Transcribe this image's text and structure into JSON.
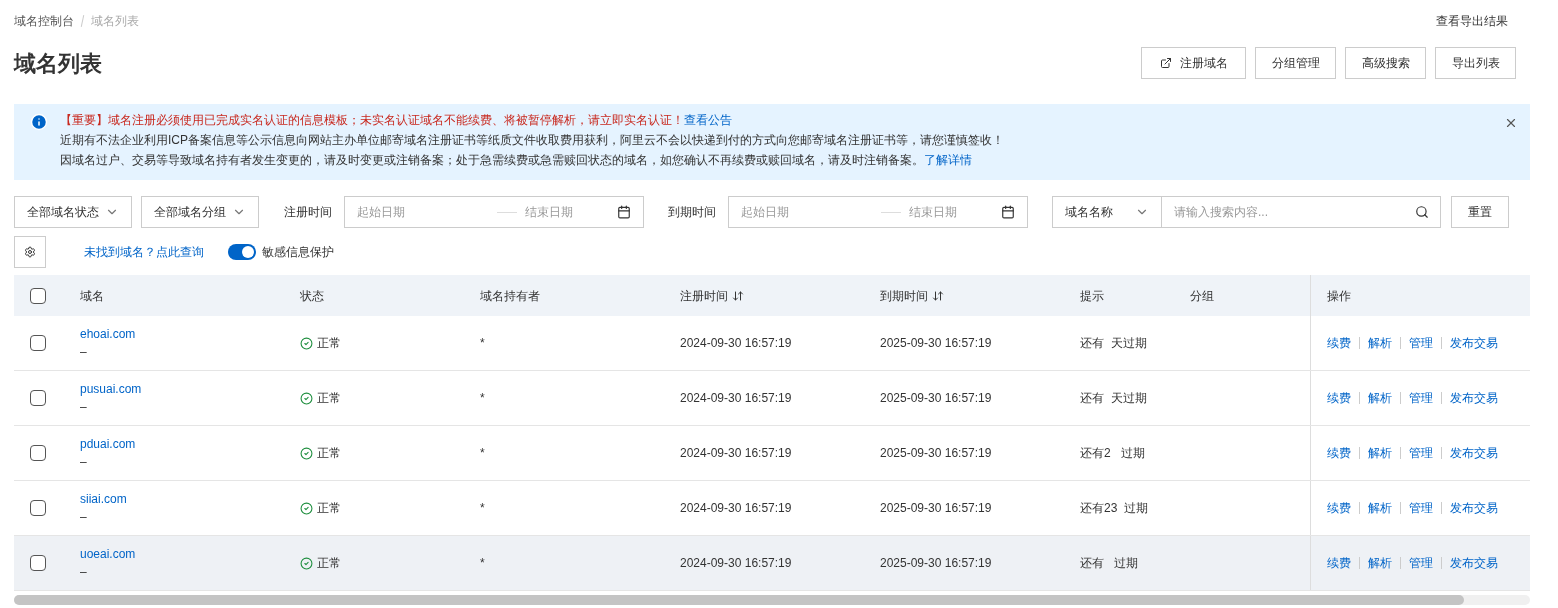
{
  "breadcrumb": [
    {
      "label": "域名控制台",
      "current": false
    },
    {
      "label": "域名列表",
      "current": true
    }
  ],
  "export_results_link": "查看导出结果",
  "title": "域名列表",
  "toolbar_buttons": [
    {
      "label": "注册域名",
      "kind": "external"
    },
    {
      "label": "分组管理",
      "kind": "plain"
    },
    {
      "label": "高级搜索",
      "kind": "plain"
    },
    {
      "label": "导出列表",
      "kind": "plain"
    }
  ],
  "notice": {
    "important": "【重要】域名注册必须使用已完成实名认证的信息模板；未实名认证域名不能续费、将被暂停解析，请立即实名认证！",
    "important_link": "查看公告",
    "line_2": "近期有不法企业利用ICP备案信息等公示信息向网站主办单位邮寄域名注册证书等纸质文件收取费用获利，阿里云不会以快递到付的方式向您邮寄域名注册证书等，请您谨慎签收！",
    "line_3": "因域名过户、交易等导致域名持有者发生变更的，请及时变更或注销备案；处于急需续费或急需赎回状态的域名，如您确认不再续费或赎回域名，请及时注销备案。",
    "line_3_link": "了解详情"
  },
  "filters": {
    "status_select": "全部域名状态",
    "group_select": "全部域名分组",
    "reg_label": "注册时间",
    "reg_start": "起始日期",
    "reg_end": "结束日期",
    "exp_label": "到期时间",
    "exp_start": "起始日期",
    "exp_end": "结束日期",
    "search_type": "域名名称",
    "search_placeholder": "请输入搜索内容...",
    "reset": "重置"
  },
  "not_found_link": "未找到域名？点此查询",
  "sensitive_toggle": {
    "label": "敏感信息保护",
    "on": true
  },
  "table": {
    "select_all_checked": false,
    "columns": [
      {
        "label": "域名",
        "sortable": false
      },
      {
        "label": "状态",
        "sortable": false
      },
      {
        "label": "域名持有者",
        "sortable": false
      },
      {
        "label": "注册时间",
        "sortable": true
      },
      {
        "label": "到期时间",
        "sortable": true
      },
      {
        "label": "提示",
        "sortable": false
      },
      {
        "label": "分组",
        "sortable": false
      },
      {
        "label": "操作",
        "sortable": false
      }
    ],
    "rows": [
      {
        "checked": false,
        "highlighted": false,
        "domain": "ehoai.com",
        "sub": "–",
        "status": "正常",
        "owner": "*",
        "registered": "2024-09-30 16:57:19",
        "expires": "2025-09-30 16:57:19",
        "hint": "还有  天过期",
        "actions": [
          "续费",
          "解析",
          "管理",
          "发布交易"
        ]
      },
      {
        "checked": false,
        "highlighted": false,
        "domain": "pusuai.com",
        "sub": "–",
        "status": "正常",
        "owner": "*",
        "registered": "2024-09-30 16:57:19",
        "expires": "2025-09-30 16:57:19",
        "hint": "还有  天过期",
        "actions": [
          "续费",
          "解析",
          "管理",
          "发布交易"
        ]
      },
      {
        "checked": false,
        "highlighted": false,
        "domain": "pduai.com",
        "sub": "–",
        "status": "正常",
        "owner": "*",
        "registered": "2024-09-30 16:57:19",
        "expires": "2025-09-30 16:57:19",
        "hint": "还有2   过期",
        "actions": [
          "续费",
          "解析",
          "管理",
          "发布交易"
        ]
      },
      {
        "checked": false,
        "highlighted": false,
        "domain": "siiai.com",
        "sub": "–",
        "status": "正常",
        "owner": "*",
        "registered": "2024-09-30 16:57:19",
        "expires": "2025-09-30 16:57:19",
        "hint": "还有23  过期",
        "actions": [
          "续费",
          "解析",
          "管理",
          "发布交易"
        ]
      },
      {
        "checked": false,
        "highlighted": true,
        "domain": "uoeai.com",
        "sub": "–",
        "status": "正常",
        "owner": "*",
        "registered": "2024-09-30 16:57:19",
        "expires": "2025-09-30 16:57:19",
        "hint": "还有   过期",
        "actions": [
          "续费",
          "解析",
          "管理",
          "发布交易"
        ]
      }
    ]
  }
}
